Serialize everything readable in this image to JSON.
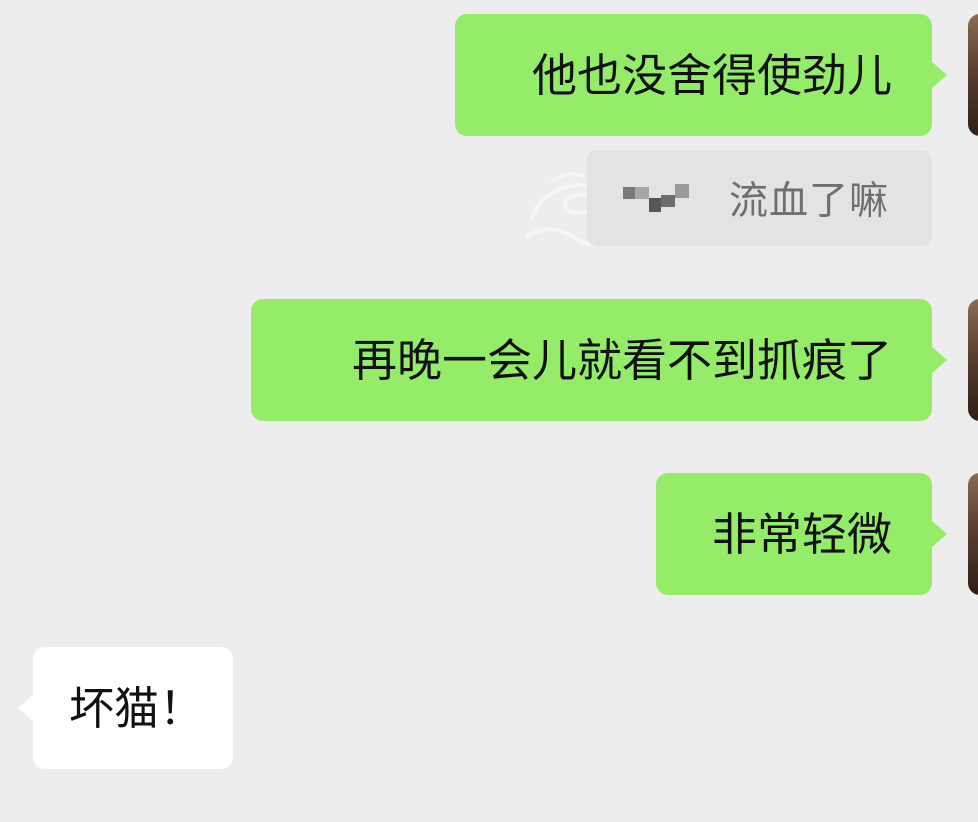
{
  "messages": [
    {
      "direction": "outgoing",
      "text": "他也没舍得使劲儿"
    },
    {
      "direction": "outgoing-quote",
      "quoted_text": "流血了嘛"
    },
    {
      "direction": "outgoing",
      "text": "再晚一会儿就看不到抓痕了"
    },
    {
      "direction": "outgoing",
      "text": "非常轻微"
    },
    {
      "direction": "incoming",
      "text": "坏猫！"
    }
  ],
  "colors": {
    "background": "#ededed",
    "outgoing_bubble": "#95ec69",
    "incoming_bubble": "#ffffff",
    "quote_bubble": "#e3e3e3"
  }
}
